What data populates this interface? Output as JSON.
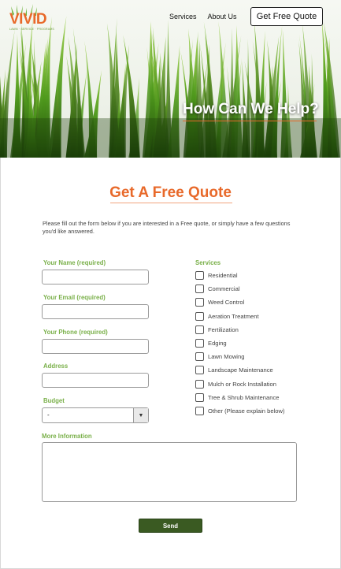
{
  "brand": {
    "logo_text": "VIVID",
    "logo_tagline": "LAWN · SERVICE · PROGRAMS",
    "orange": "#e8692a",
    "green": "#7ab04a",
    "dark_green": "#3a5a22"
  },
  "nav": {
    "items": [
      "Services",
      "About Us"
    ],
    "cta_label": "Get Free Quote"
  },
  "hero": {
    "title": "How Can We Help?"
  },
  "form": {
    "title": "Get A Free Quote",
    "intro": "Please fill out the form below if you are interested in a Free quote, or simply have a few questions you'd like answered.",
    "name_label": "Your Name (required)",
    "email_label": "Your Email (required)",
    "phone_label": "Your Phone (required)",
    "address_label": "Address",
    "budget_label": "Budget",
    "budget_value": "-",
    "more_info_label": "More Information",
    "send_label": "Send"
  },
  "services": {
    "heading": "Services",
    "items": [
      "Residential",
      "Commercial",
      "Weed Control",
      "Aeration Treatment",
      "Fertilization",
      "Edging",
      "Lawn Mowing",
      "Landscape Maintenance",
      "Mulch or Rock Installation",
      "Tree & Shrub Maintenance",
      "Other (Please explain below)"
    ]
  }
}
